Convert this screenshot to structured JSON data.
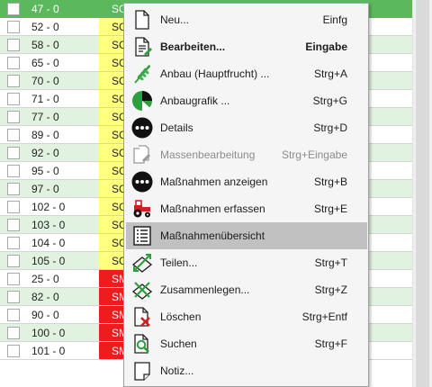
{
  "rows": [
    {
      "name": "47 - 0",
      "type": "SG",
      "color": "selected"
    },
    {
      "name": "52 - 0",
      "type": "SG",
      "color": "yellow"
    },
    {
      "name": "58 - 0",
      "type": "SG",
      "color": "yellow"
    },
    {
      "name": "65 - 0",
      "type": "SG",
      "color": "yellow"
    },
    {
      "name": "70 - 0",
      "type": "SG",
      "color": "yellow"
    },
    {
      "name": "71 - 0",
      "type": "SG",
      "color": "yellow"
    },
    {
      "name": "77 - 0",
      "type": "SG",
      "color": "yellow"
    },
    {
      "name": "89 - 0",
      "type": "SG",
      "color": "yellow"
    },
    {
      "name": "92 - 0",
      "type": "SG",
      "color": "yellow"
    },
    {
      "name": "95 - 0",
      "type": "SG",
      "color": "yellow"
    },
    {
      "name": "97 - 0",
      "type": "SG",
      "color": "yellow"
    },
    {
      "name": "102 - 0",
      "type": "SG",
      "color": "yellow"
    },
    {
      "name": "103 - 0",
      "type": "SG",
      "color": "yellow"
    },
    {
      "name": "104 - 0",
      "type": "SG",
      "color": "yellow"
    },
    {
      "name": "105 - 0",
      "type": "SG",
      "color": "yellow"
    },
    {
      "name": "25 - 0",
      "type": "SM",
      "color": "red"
    },
    {
      "name": "82 - 0",
      "type": "SM",
      "color": "red"
    },
    {
      "name": "90 - 0",
      "type": "SM",
      "color": "red"
    },
    {
      "name": "100 - 0",
      "type": "SM",
      "color": "red"
    },
    {
      "name": "101 - 0",
      "type": "SM",
      "color": "red"
    }
  ],
  "menu": {
    "items": [
      {
        "label": "Neu...",
        "shortcut": "Einfg",
        "icon": "new-document-icon"
      },
      {
        "label": "Bearbeiten...",
        "shortcut": "Eingabe",
        "icon": "edit-document-icon",
        "bold": true
      },
      {
        "label": "Anbau (Hauptfrucht) ...",
        "shortcut": "Strg+A",
        "icon": "wheat-icon"
      },
      {
        "label": "Anbaugrafik ...",
        "shortcut": "Strg+G",
        "icon": "pie-chart-icon"
      },
      {
        "label": "Details",
        "shortcut": "Strg+D",
        "icon": "details-dots-icon"
      },
      {
        "label": "Massenbearbeitung",
        "shortcut": "Strg+Eingabe",
        "icon": "mass-edit-icon",
        "disabled": true
      },
      {
        "label": "Maßnahmen anzeigen",
        "shortcut": "Strg+B",
        "icon": "measures-dots-icon"
      },
      {
        "label": "Maßnahmen erfassen",
        "shortcut": "Strg+E",
        "icon": "tractor-icon"
      },
      {
        "label": "Maßnahmenübersicht",
        "shortcut": "",
        "icon": "list-icon",
        "highlighted": true
      },
      {
        "label": "Teilen...",
        "shortcut": "Strg+T",
        "icon": "split-icon"
      },
      {
        "label": "Zusammenlegen...",
        "shortcut": "Strg+Z",
        "icon": "merge-icon"
      },
      {
        "label": "Löschen",
        "shortcut": "Strg+Entf",
        "icon": "delete-document-icon"
      },
      {
        "label": "Suchen",
        "shortcut": "Strg+F",
        "icon": "search-document-icon"
      },
      {
        "label": "Notiz...",
        "shortcut": "",
        "icon": "note-icon"
      }
    ]
  },
  "colors": {
    "selected_row": "#5cb85c",
    "alt_row": "#e1f2e1",
    "yellow_cell": "#ffff80",
    "red_cell": "#ee1c1c",
    "menu_highlight": "#c1c1c1",
    "icon_green": "#2e9e3e",
    "icon_red": "#d21f1f"
  }
}
